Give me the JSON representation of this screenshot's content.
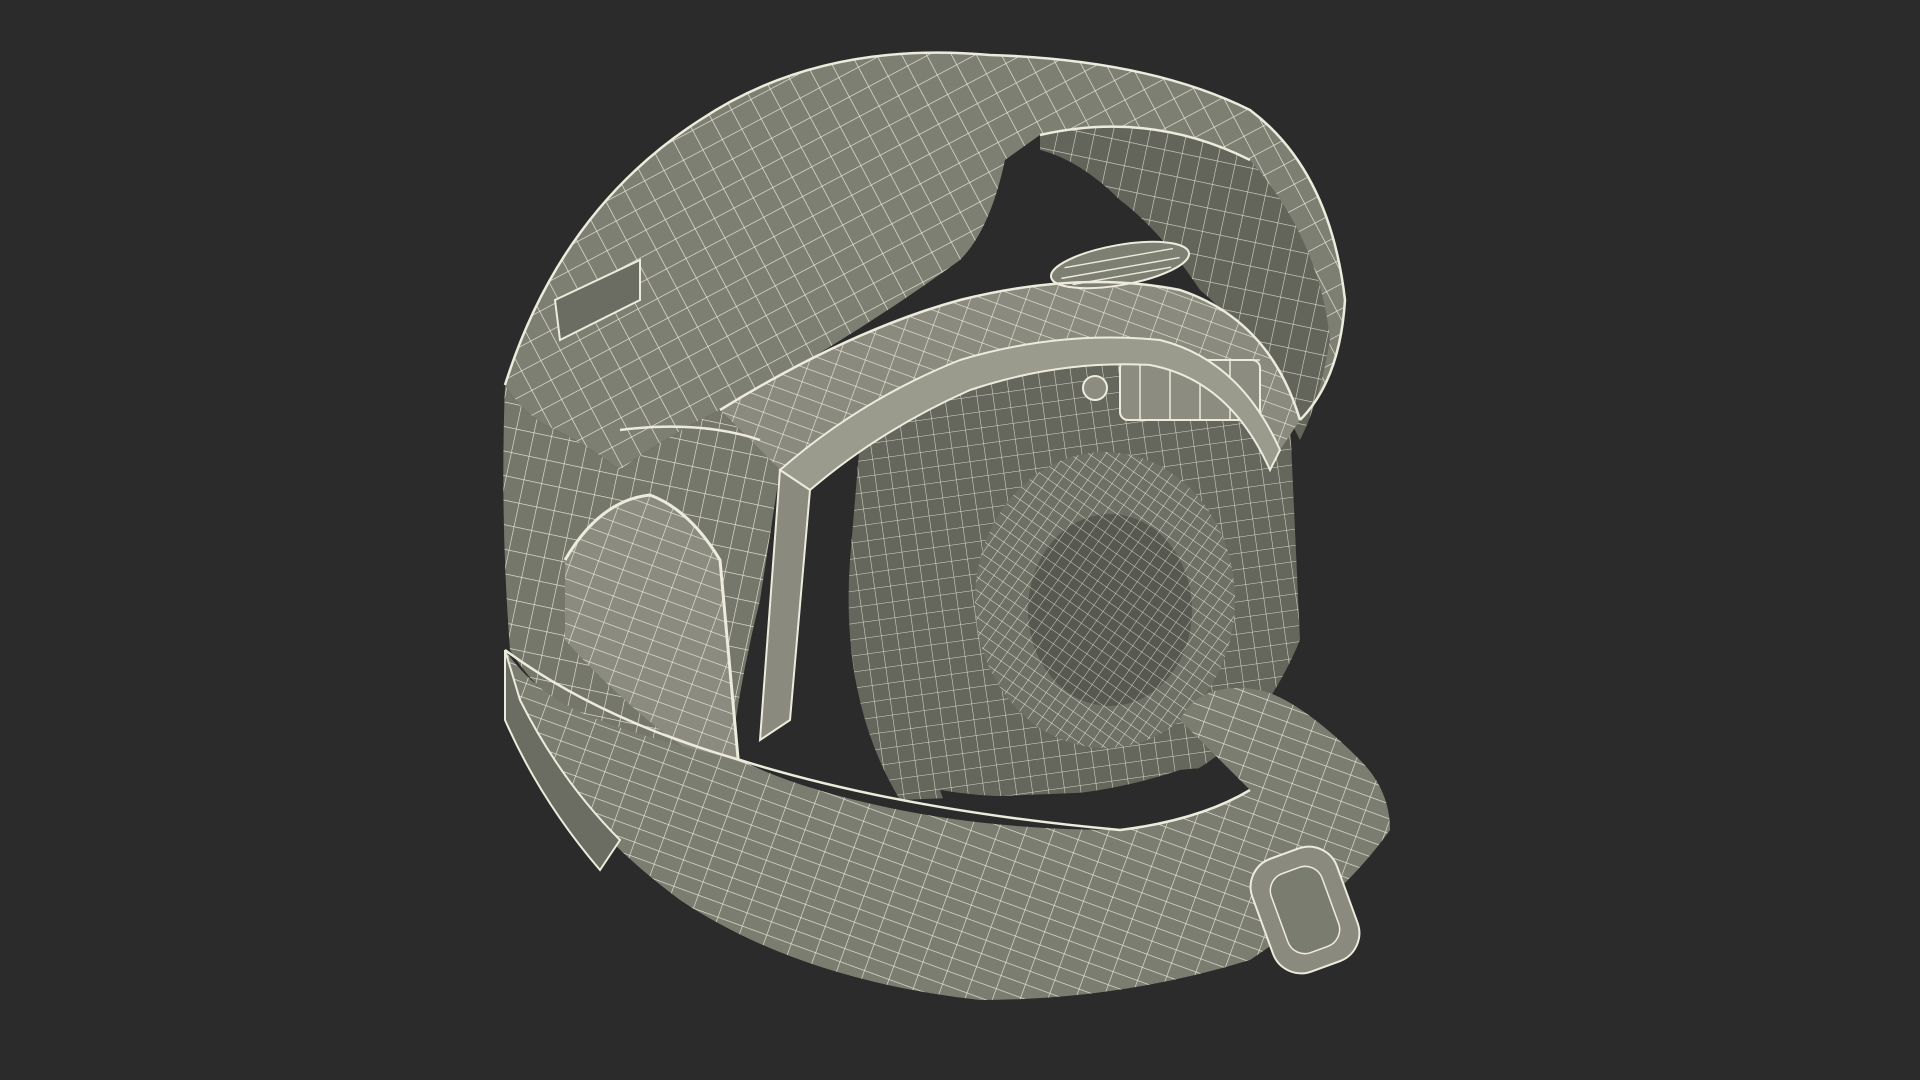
{
  "scene": {
    "subject": "helmet-wireframe-render",
    "colors": {
      "background": "#2b2b2b",
      "shell": "#7b7c70",
      "shell_light": "#8c8d80",
      "shell_dark": "#5f6057",
      "interior": "#6a6b60",
      "cavity": "#2b2b2b",
      "wire": "#ecebdc"
    }
  }
}
